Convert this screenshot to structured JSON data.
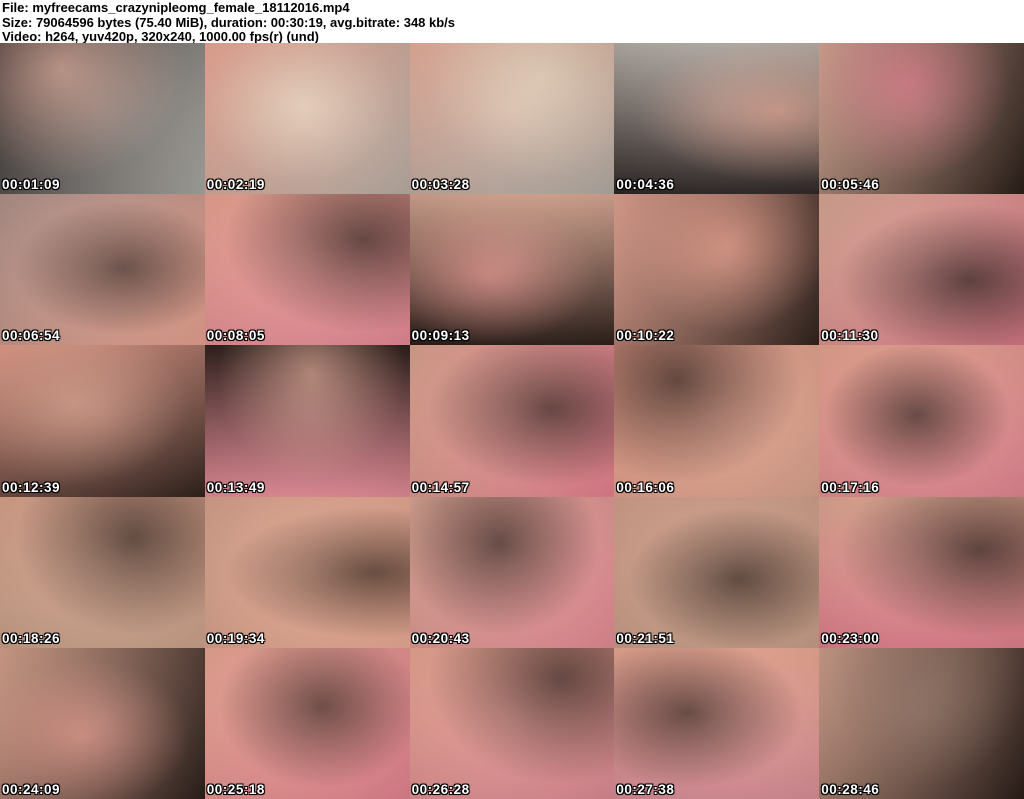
{
  "header": {
    "file_line": "File: myfreecams_crazynipleomg_female_18112016.mp4",
    "size_line": "Size: 79064596 bytes (75.40 MiB), duration: 00:30:19, avg.bitrate: 348 kb/s",
    "video_line": "Video: h264, yuv420p, 320x240, 1000.00 fps(r) (und)"
  },
  "grid": {
    "columns": 5,
    "rows": 5,
    "thumbnails": [
      {
        "t": "00:01:09",
        "c1": "#3a3331",
        "c2": "#a9a7a2",
        "c3": "#e9b2a0"
      },
      {
        "t": "00:02:19",
        "c1": "#edaa97",
        "c2": "#b9aea4",
        "c3": "#e8d8c2"
      },
      {
        "t": "00:03:28",
        "c1": "#e8b09c",
        "c2": "#b3aca4",
        "c3": "#e6d9c2"
      },
      {
        "t": "00:04:36",
        "c1": "#b9b2ab",
        "c2": "#2e2624",
        "c3": "#eba893"
      },
      {
        "t": "00:05:46",
        "c1": "#d8ab97",
        "c2": "#2a1e18",
        "c3": "#e0788a"
      },
      {
        "t": "00:06:54",
        "c1": "#b0928a",
        "c2": "#e6a18f",
        "c3": "#3a2a24"
      },
      {
        "t": "00:08:05",
        "c1": "#eba493",
        "c2": "#e58a97",
        "c3": "#2f211c"
      },
      {
        "t": "00:09:13",
        "c1": "#d9a893",
        "c2": "#2b1d18",
        "c3": "#e8958f"
      },
      {
        "t": "00:10:22",
        "c1": "#e3a391",
        "c2": "#30221c",
        "c3": "#ec9f8b"
      },
      {
        "t": "00:11:30",
        "c1": "#d8a794",
        "c2": "#e17d8c",
        "c3": "#241a16"
      },
      {
        "t": "00:12:39",
        "c1": "#e89f8d",
        "c2": "#31221c",
        "c3": "#d8a18c"
      },
      {
        "t": "00:13:49",
        "c1": "#2b1e19",
        "c2": "#e98f9a",
        "c3": "#dca794"
      },
      {
        "t": "00:14:57",
        "c1": "#dca38f",
        "c2": "#e4808f",
        "c3": "#2e201a"
      },
      {
        "t": "00:16:06",
        "c1": "#eca28e",
        "c2": "#d9a38e",
        "c3": "#2a1c17"
      },
      {
        "t": "00:17:16",
        "c1": "#e7a490",
        "c2": "#e28693",
        "c3": "#281b16"
      },
      {
        "t": "00:18:26",
        "c1": "#d9a38c",
        "c2": "#caa28b",
        "c3": "#2e211b"
      },
      {
        "t": "00:19:34",
        "c1": "#d6a28c",
        "c2": "#e9aa95",
        "c3": "#342419"
      },
      {
        "t": "00:20:43",
        "c1": "#dba794",
        "c2": "#e58b95",
        "c3": "#2c1f1a"
      },
      {
        "t": "00:21:51",
        "c1": "#d3a08b",
        "c2": "#c79f89",
        "c3": "#2b1e18"
      },
      {
        "t": "00:23:00",
        "c1": "#dfa892",
        "c2": "#e07f8d",
        "c3": "#261a15"
      },
      {
        "t": "00:24:09",
        "c1": "#d7a28d",
        "c2": "#2c1f1a",
        "c3": "#e5988c"
      },
      {
        "t": "00:25:18",
        "c1": "#eba795",
        "c2": "#e2828f",
        "c3": "#33231c"
      },
      {
        "t": "00:26:28",
        "c1": "#e9a692",
        "c2": "#dd8a94",
        "c3": "#2f211b"
      },
      {
        "t": "00:27:38",
        "c1": "#eaa893",
        "c2": "#d98e97",
        "c3": "#2d1f19"
      },
      {
        "t": "00:28:46",
        "c1": "#cf9f8b",
        "c2": "#2a1d18",
        "c3": "#8c6f61"
      }
    ]
  },
  "colors": {
    "header_bg": "#ffffff",
    "header_text": "#000000",
    "timestamp_text": "#ffffff",
    "timestamp_outline": "#000000"
  }
}
